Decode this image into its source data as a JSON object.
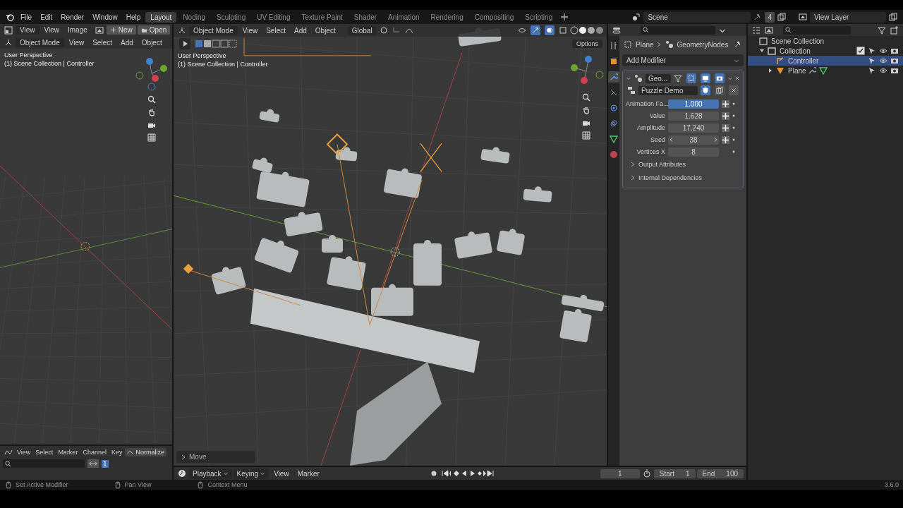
{
  "topbar": {
    "menus": [
      "File",
      "Edit",
      "Render",
      "Window",
      "Help"
    ],
    "workspaces": [
      {
        "label": "Layout",
        "selected": true
      },
      {
        "label": "Noding",
        "selected": false
      },
      {
        "label": "Sculpting",
        "selected": false
      },
      {
        "label": "UV Editing",
        "selected": false
      },
      {
        "label": "Texture Paint",
        "selected": false
      },
      {
        "label": "Shader",
        "selected": false
      },
      {
        "label": "Animation",
        "selected": false
      },
      {
        "label": "Rendering",
        "selected": false
      },
      {
        "label": "Compositing",
        "selected": false
      },
      {
        "label": "Scripting",
        "selected": false
      }
    ],
    "scene": "Scene",
    "scene_users": "4",
    "view_layer": "View Layer"
  },
  "image_editor": {
    "view_mode": "View",
    "menus": [
      "View",
      "Image"
    ],
    "new_button": "New",
    "open_button": "Open"
  },
  "side_viewport": {
    "mode": "Object Mode",
    "menus": [
      "View",
      "Select",
      "Add",
      "Object"
    ],
    "perspective": "User Perspective",
    "collection": "(1) Scene Collection | Controller"
  },
  "graph_editor": {
    "menus": [
      "View",
      "Select",
      "Marker",
      "Channel",
      "Key"
    ],
    "normalize": {
      "label": "Normalize",
      "on": false
    },
    "current_frame": "1"
  },
  "main_viewport": {
    "mode": "Object Mode",
    "menus": [
      "View",
      "Select",
      "Add",
      "Object"
    ],
    "orientation": "Global",
    "options": "Options",
    "perspective": "User Perspective",
    "collection": "(1) Scene Collection | Controller",
    "last_operator": "Move"
  },
  "properties": {
    "object": "Plane",
    "modifier_path": "GeometryNodes",
    "add_modifier": "Add Modifier",
    "modifier_name": "Geo...",
    "node_group": "Puzzle Demo",
    "inputs": [
      {
        "label": "Animation Fa...",
        "value": "1.000",
        "kind": "field",
        "selected": true
      },
      {
        "label": "Value",
        "value": "1.628",
        "kind": "field",
        "selected": false
      },
      {
        "label": "Amplitude",
        "value": "17.240",
        "kind": "field",
        "selected": false
      },
      {
        "label": "Seed",
        "value": "38",
        "kind": "stepper",
        "selected": false
      },
      {
        "label": "Vertices X",
        "value": "8",
        "kind": "plain",
        "selected": false
      }
    ],
    "panels": [
      {
        "label": "Output Attributes",
        "expanded": false
      },
      {
        "label": "Internal Dependencies",
        "expanded": false
      }
    ]
  },
  "outliner": {
    "tree": [
      {
        "label": "Scene Collection",
        "kind": "scene",
        "selected": false,
        "children": [
          {
            "label": "Collection",
            "kind": "collection",
            "expanded": true,
            "checked": true,
            "selected": false,
            "children": [
              {
                "label": "Controller",
                "kind": "empty",
                "selected": true
              },
              {
                "label": "Plane",
                "kind": "mesh",
                "expanded": false,
                "selected": false
              }
            ]
          }
        ]
      }
    ]
  },
  "timeline": {
    "menus": [
      {
        "label": "Playback",
        "dropdown": true
      },
      {
        "label": "Keying",
        "dropdown": true
      },
      {
        "label": "View",
        "dropdown": false
      },
      {
        "label": "Marker",
        "dropdown": false
      }
    ],
    "current_frame": "1",
    "start_label": "Start",
    "start": "1",
    "end_label": "End",
    "end": "100"
  },
  "status_bar": {
    "hints": [
      "Set Active Modifier",
      "Pan View",
      "Context Menu"
    ],
    "version": "3.6.0"
  }
}
